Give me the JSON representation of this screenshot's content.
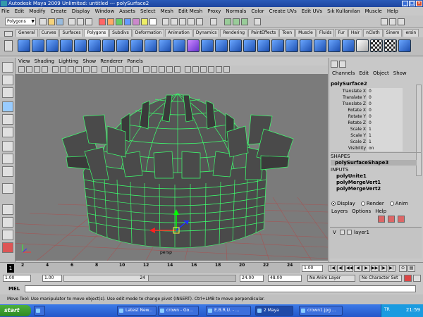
{
  "window": {
    "title": "Autodesk Maya 2009 Unlimited: untitled   ---   polySurface2",
    "min": "_",
    "max": "□",
    "close": "×"
  },
  "menubar": [
    "File",
    "Edit",
    "Modify",
    "Create",
    "Display",
    "Window",
    "Assets",
    "Select",
    "Mesh",
    "Edit Mesh",
    "Proxy",
    "Normals",
    "Color",
    "Create UVs",
    "Edit UVs",
    "Sık Kullanılan",
    "Muscle",
    "Help"
  ],
  "statusline": {
    "mode": "Polygons"
  },
  "shelf": {
    "tabs": [
      "General",
      "Curves",
      "Surfaces",
      "Polygons",
      "Subdivs",
      "Deformation",
      "Animation",
      "Dynamics",
      "Rendering",
      "PaintEffects",
      "Toon",
      "Muscle",
      "Fluids",
      "Fur",
      "Hair",
      "nCloth",
      "Sinem",
      "ersin"
    ],
    "active_tab": "Polygons"
  },
  "panel": {
    "menu": [
      "View",
      "Shading",
      "Lighting",
      "Show",
      "Renderer",
      "Panels"
    ],
    "camera": "persp"
  },
  "channel_box": {
    "menu": [
      "Channels",
      "Edit",
      "Object",
      "Show"
    ],
    "object_name": "polySurface2",
    "attributes": [
      {
        "label": "Translate X",
        "value": "0"
      },
      {
        "label": "Translate Y",
        "value": "0"
      },
      {
        "label": "Translate Z",
        "value": "0"
      },
      {
        "label": "Rotate X",
        "value": "0"
      },
      {
        "label": "Rotate Y",
        "value": "0"
      },
      {
        "label": "Rotate Z",
        "value": "0"
      },
      {
        "label": "Scale X",
        "value": "1"
      },
      {
        "label": "Scale Y",
        "value": "1"
      },
      {
        "label": "Scale Z",
        "value": "1"
      },
      {
        "label": "Visibility",
        "value": "on"
      }
    ],
    "shapes_header": "SHAPES",
    "shape_name": "polySurfaceShape3",
    "inputs_header": "INPUTS",
    "inputs": [
      "polyUnite1",
      "polyMergeVert1",
      "polyMergeVert2"
    ]
  },
  "layer_editor": {
    "modes": [
      {
        "label": "Display",
        "selected": true
      },
      {
        "label": "Render",
        "selected": false
      },
      {
        "label": "Anim",
        "selected": false
      }
    ],
    "menu": [
      "Layers",
      "Options",
      "Help"
    ],
    "layer_v": "V",
    "layer_name": "layer1"
  },
  "time_slider": {
    "ticks": [
      "2",
      "4",
      "6",
      "8",
      "10",
      "12",
      "14",
      "16",
      "18",
      "20",
      "22",
      "24"
    ],
    "current_frame_marker": "1",
    "current_frame": "1.00"
  },
  "range_slider": {
    "start": "1.00",
    "playback_start": "1.00",
    "range_display": "24",
    "playback_end": "24.00",
    "end": "48.00",
    "anim_layer": "No Anim Layer",
    "character_set": "No Character Set"
  },
  "mel": {
    "label": "MEL"
  },
  "help_line": "Move Tool: Use manipulator to move object(s). Use edit mode to change pivot (INSERT). Ctrl+LMB to move perpendicular.",
  "taskbar": {
    "start": "start",
    "items": [
      "Latest New...",
      "crown - Go...",
      "E.B.R.U. - ...",
      "2 Maya",
      "crown1.jpg ..."
    ],
    "locale": "TR",
    "clock": "21:59"
  },
  "colors": {
    "mesh_face": "#4a4a4a",
    "mesh_wire": "#3dff6e",
    "viewport_bg": "#7b7b7b",
    "grid_line": "#b04a4a",
    "titlebar": "#2a5ab8"
  }
}
